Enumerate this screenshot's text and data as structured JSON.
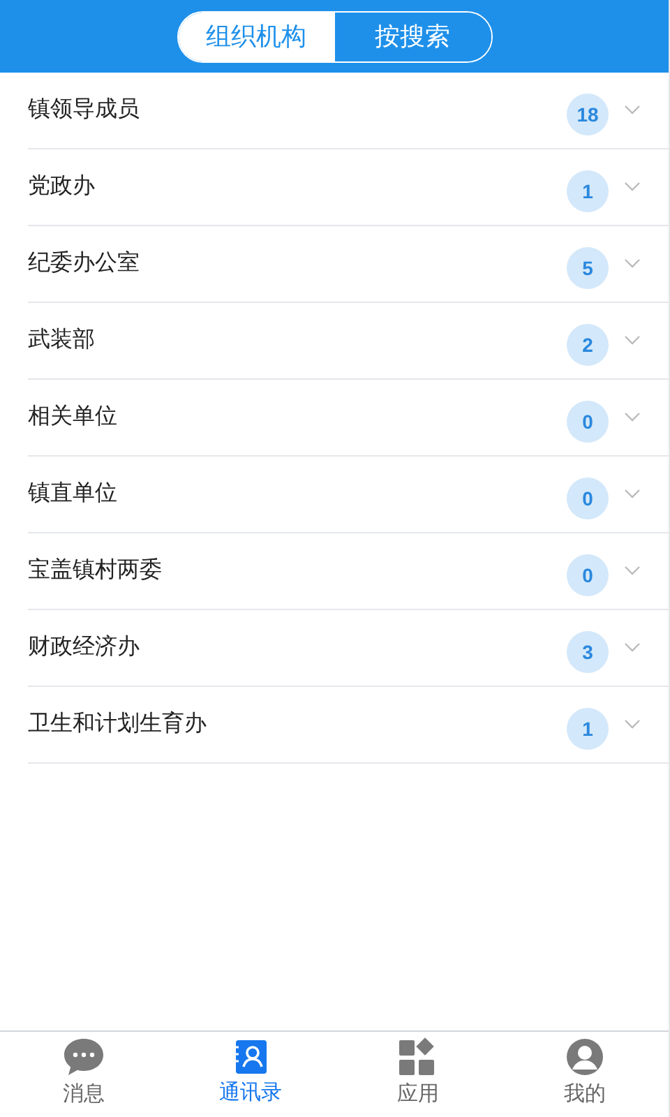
{
  "segments": [
    {
      "label": "组织机构",
      "selected": true
    },
    {
      "label": "按搜索",
      "selected": false
    }
  ],
  "groups": [
    {
      "name": "镇领导成员",
      "count": "18"
    },
    {
      "name": "党政办",
      "count": "1"
    },
    {
      "name": "纪委办公室",
      "count": "5"
    },
    {
      "name": "武装部",
      "count": "2"
    },
    {
      "name": "相关单位",
      "count": "0"
    },
    {
      "name": "镇直单位",
      "count": "0"
    },
    {
      "name": "宝盖镇村两委",
      "count": "0"
    },
    {
      "name": "财政经济办",
      "count": "3"
    },
    {
      "name": "卫生和计划生育办",
      "count": "1"
    }
  ],
  "tab_bar": [
    {
      "kind": "chat",
      "label": "消息",
      "selected": false
    },
    {
      "kind": "contacts",
      "label": "通讯录",
      "selected": true
    },
    {
      "kind": "apps",
      "label": "应用",
      "selected": false
    },
    {
      "kind": "person",
      "label": "我的",
      "selected": false
    }
  ]
}
